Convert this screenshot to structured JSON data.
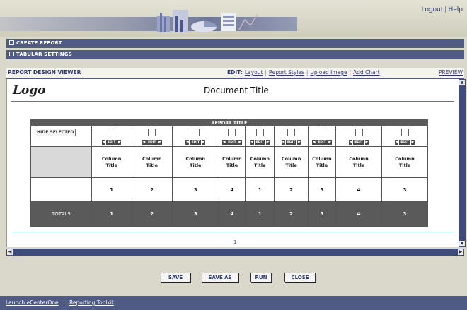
{
  "header": {
    "links": [
      "Logout",
      "Help"
    ]
  },
  "sections": {
    "create_report": "CREATE REPORT",
    "tabular_settings": "TABULAR SETTINGS"
  },
  "viewer": {
    "title": "REPORT DESIGN VIEWER",
    "edit_label": "EDIT:",
    "edit_links": [
      "Layout",
      "Report Styles",
      "Upload Image",
      "Add Chart"
    ],
    "preview": "PREVIEW"
  },
  "document": {
    "logo": "Logo",
    "title": "Document Title",
    "page_number": "1"
  },
  "report": {
    "title": "REPORT TITLE",
    "hide_selected": "HIDE SELECTED",
    "edit_label": "EDIT",
    "totals_label": "TOTALS",
    "columns": [
      {
        "title_line1": "Column",
        "title_line2": "Title",
        "value": "1",
        "total": "1"
      },
      {
        "title_line1": "Column",
        "title_line2": "Title",
        "value": "2",
        "total": "2"
      },
      {
        "title_line1": "Column",
        "title_line2": "Title",
        "value": "3",
        "total": "3"
      },
      {
        "title_line1": "Column",
        "title_line2": "Title",
        "value": "4",
        "total": "4"
      },
      {
        "title_line1": "Column",
        "title_line2": "Title",
        "value": "1",
        "total": "1"
      },
      {
        "title_line1": "Column",
        "title_line2": "Title",
        "value": "2",
        "total": "2"
      },
      {
        "title_line1": "Column",
        "title_line2": "Title",
        "value": "3",
        "total": "3"
      },
      {
        "title_line1": "Column",
        "title_line2": "Title",
        "value": "4",
        "total": "4"
      },
      {
        "title_line1": "Column",
        "title_line2": "Title",
        "value": "3",
        "total": "3"
      }
    ]
  },
  "actions": {
    "save": "SAVE",
    "save_as": "SAVE AS",
    "run": "RUN",
    "close": "CLOSE"
  },
  "footer": {
    "launch": "Launch eCenterOne",
    "toolkit": "Reporting Toolkit"
  },
  "colors": {
    "nav_bar": "#4f5b84",
    "totals_row": "#5a5a5a",
    "accent_rule": "#3a8a88"
  }
}
